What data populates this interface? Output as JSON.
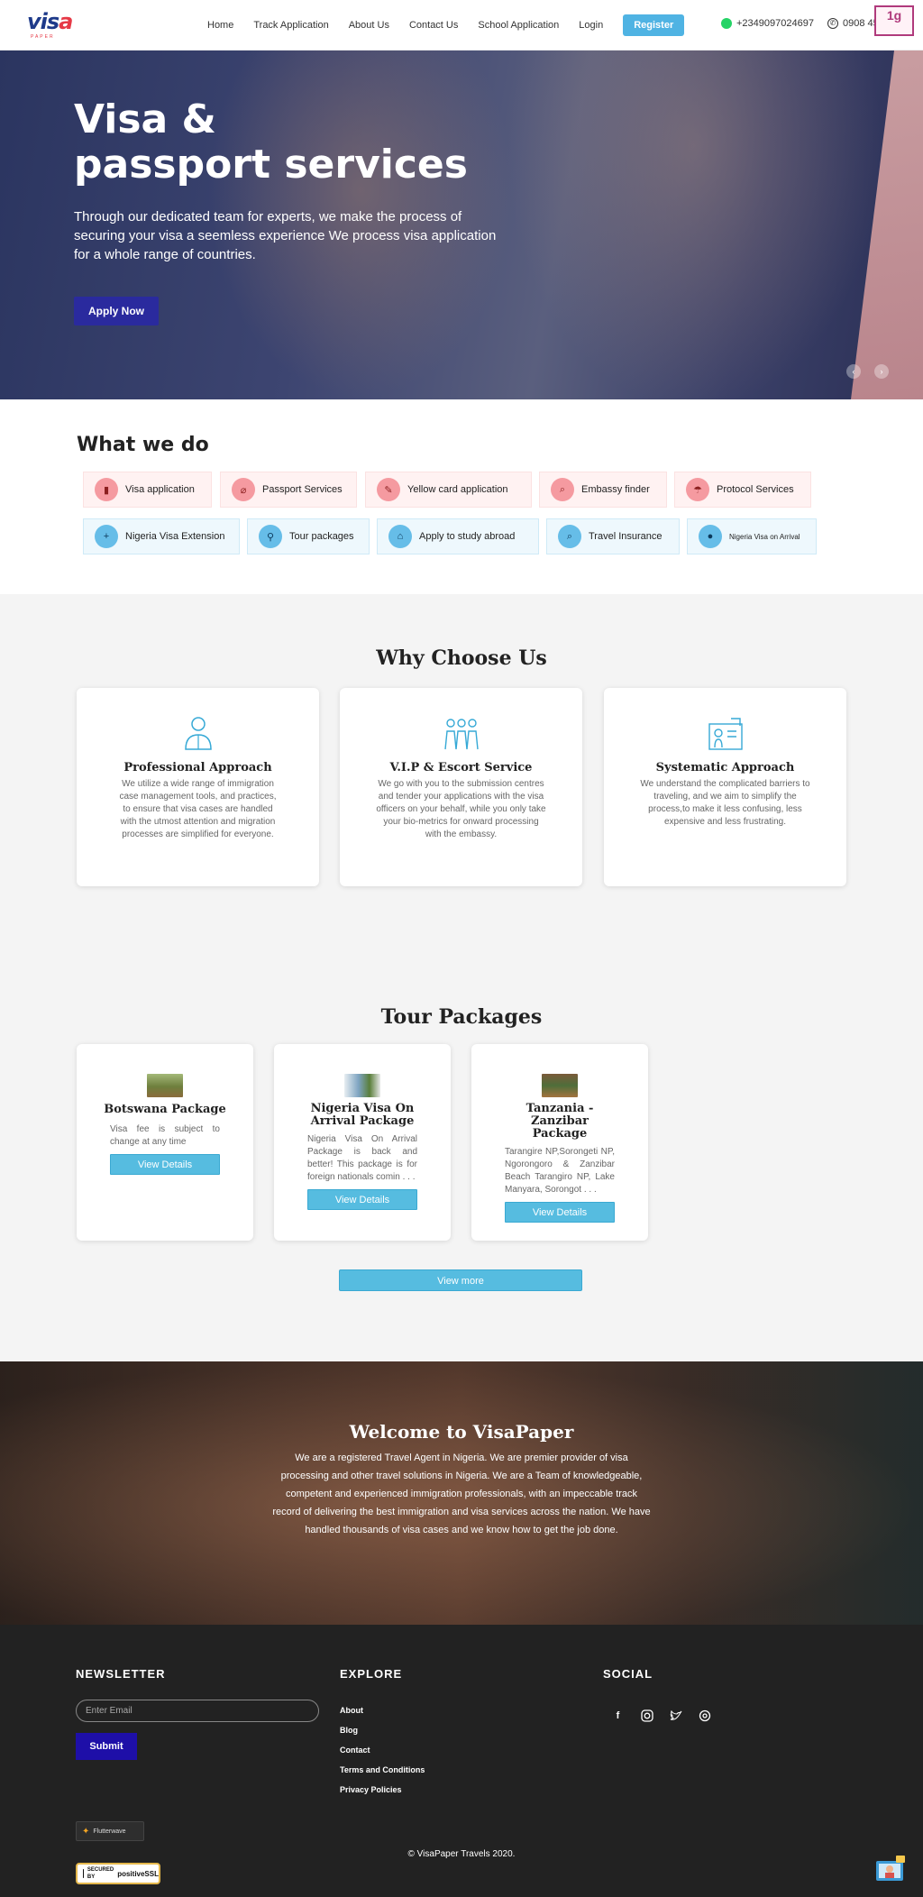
{
  "header": {
    "logo": {
      "word_a": "vis",
      "word_b": "a",
      "sub": "PAPER"
    },
    "nav": [
      "Home",
      "Track Application",
      "About Us",
      "Contact Us",
      "School Application",
      "Login"
    ],
    "register": "Register",
    "phone1": "+2349097024697",
    "phone2": "0908 459 0000",
    "corner_badge": "1g"
  },
  "hero": {
    "title_line1": "Visa &",
    "title_line2": "passport services",
    "text": "Through our dedicated team for experts, we make the process of securing your visa a seemless experience We process visa application for a whole range of countries.",
    "cta": "Apply Now"
  },
  "what_we_do": {
    "title": "What we do",
    "row1": [
      "Visa application",
      "Passport Services",
      "Yellow card application",
      "Embassy finder",
      "Protocol Services"
    ],
    "row2": [
      "Nigeria Visa Extension",
      "Tour packages",
      "Apply to study abroad",
      "Travel Insurance",
      "Nigeria Visa on Arrival"
    ]
  },
  "why": {
    "title": "Why Choose Us",
    "cards": [
      {
        "title": "Professional Approach",
        "text": "We utilize a wide range of immigration case management tools, and practices, to ensure that visa cases are handled with the utmost attention and migration processes are simplified for everyone."
      },
      {
        "title": "V.I.P & Escort Service",
        "text": "We go with you to the submission centres and tender your applications with the visa officers on your behalf, while you only take your bio-metrics for onward processing with the embassy."
      },
      {
        "title": "Systematic Approach",
        "text": "We understand the complicated barriers to traveling, and we aim to simplify the process,to make it less confusing, less expensive and less frustrating."
      }
    ]
  },
  "tours": {
    "title": "Tour Packages",
    "packages": [
      {
        "title": "Botswana Package",
        "text": "Visa fee is subject to change at any time",
        "button": "View Details"
      },
      {
        "title": "Nigeria Visa On Arrival Package",
        "text": "Nigeria Visa On Arrival Package is back and better! This package is for foreign nationals comin . . .",
        "button": "View Details"
      },
      {
        "title": "Tanzania - Zanzibar Package",
        "text": "Tarangire NP,Sorongeti NP, Ngorongoro & Zanzibar Beach Tarangiro NP, Lake Manyara, Sorongot . . .",
        "button": "View Details"
      }
    ],
    "view_more": "View more"
  },
  "welcome": {
    "title": "Welcome to VisaPaper",
    "text": "We are a registered Travel Agent in Nigeria. We are premier provider of visa processing and other travel solutions in Nigeria. We are a Team of knowledgeable, competent and experienced immigration professionals, with an impeccable track record of delivering the best immigration and visa services across the nation. We have handled thousands of visa cases and we know how to get the job done."
  },
  "footer": {
    "newsletter": "NEWSLETTER",
    "email_placeholder": "Enter Email",
    "submit": "Submit",
    "explore": "EXPLORE",
    "explore_links": [
      "About",
      "Blog",
      "Contact",
      "Terms and Conditions",
      "Privacy Policies"
    ],
    "social": "SOCIAL",
    "flutterwave": "Flutterwave",
    "ssl_small": "SECURED BY",
    "ssl": "positiveSSL",
    "copyright": "© VisaPaper Travels 2020."
  },
  "colors": {
    "accent": "#4fb3e3",
    "primary_button": "#2a2a9e",
    "footer_bg": "#222222"
  }
}
